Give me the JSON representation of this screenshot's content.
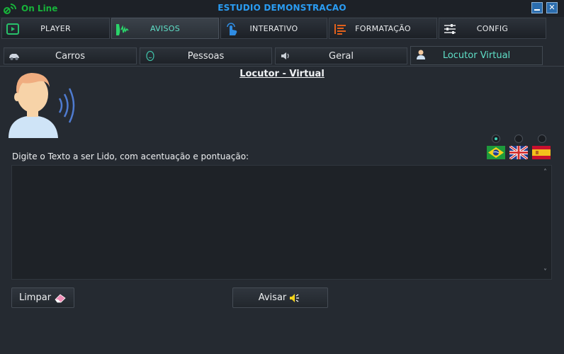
{
  "window": {
    "status": "On Line",
    "title": "ESTUDIO DEMONSTRACAO",
    "close_glyph": "✕"
  },
  "main_tabs": [
    {
      "label": "PLAYER",
      "icon": "player-icon"
    },
    {
      "label": "AVISOS",
      "icon": "audio-wave-icon",
      "active": true
    },
    {
      "label": "INTERATIVO",
      "icon": "touch-hand-icon"
    },
    {
      "label": "FORMATAÇÃO",
      "icon": "format-lines-icon"
    },
    {
      "label": "CONFIG",
      "icon": "sliders-icon"
    }
  ],
  "sub_tabs": [
    {
      "label": "Carros",
      "icon": "car-icon"
    },
    {
      "label": "Pessoas",
      "icon": "face-icon"
    },
    {
      "label": "Geral",
      "icon": "speaker-icon"
    },
    {
      "label": "Locutor Virtual",
      "icon": "person-icon",
      "active": true
    }
  ],
  "locutor": {
    "heading": "Locutor - Virtual",
    "prompt": "Digite o Texto a ser Lido, com acentuação e pontuação:",
    "text_value": "",
    "languages": [
      {
        "flag": "brazil-flag-icon",
        "selected": true
      },
      {
        "flag": "uk-flag-icon",
        "selected": false
      },
      {
        "flag": "spain-flag-icon",
        "selected": false
      }
    ],
    "clear_label": "Limpar",
    "speak_label": "Avisar",
    "scroll_up": "˄",
    "scroll_down": "˅"
  },
  "colors": {
    "background": "#252a31",
    "accent": "#5fe0c8",
    "title": "#2a9df4",
    "online": "#17b23a"
  }
}
